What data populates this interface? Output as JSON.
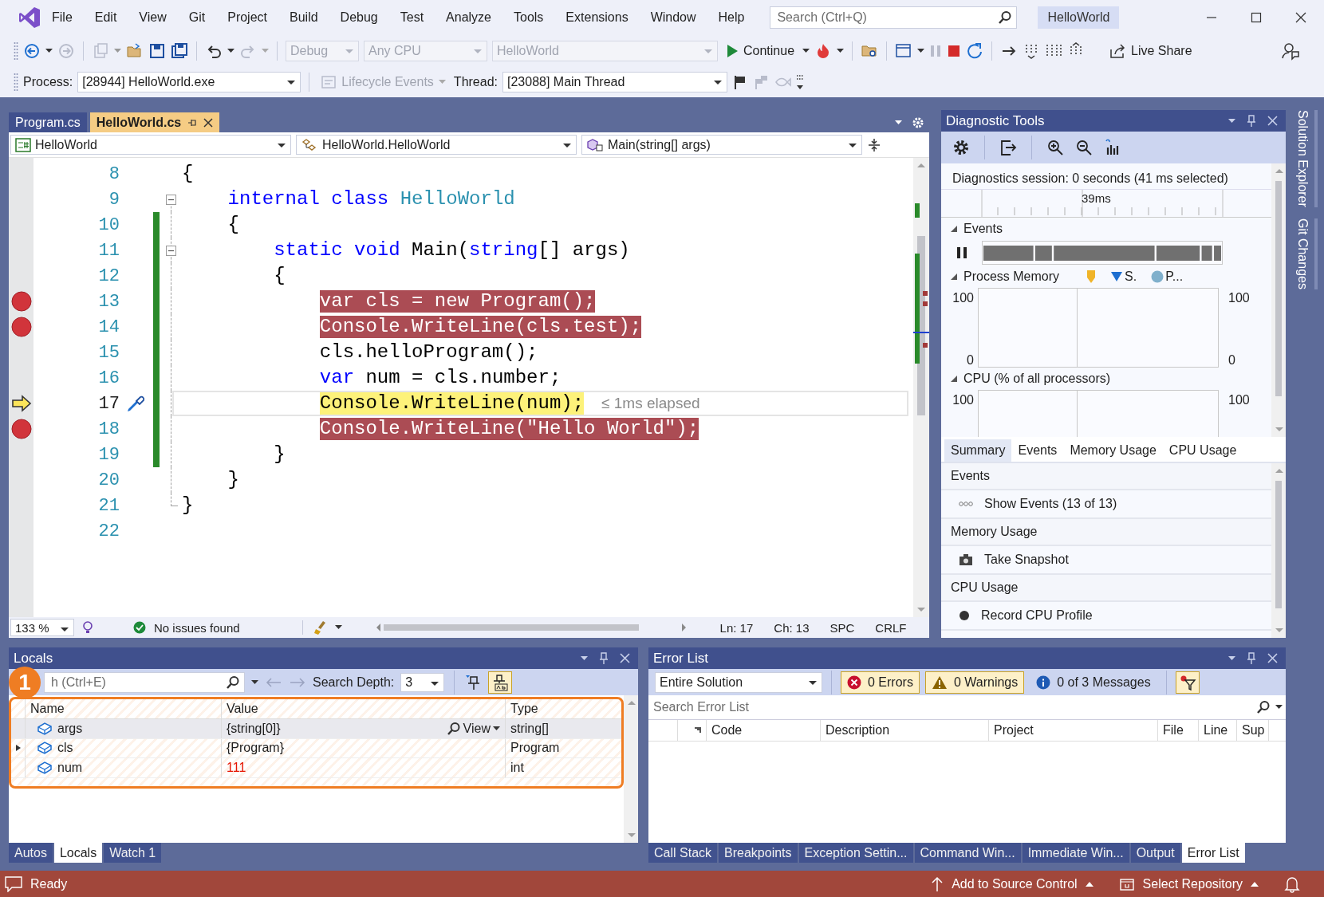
{
  "title_bar": {
    "menu": [
      "File",
      "Edit",
      "View",
      "Git",
      "Project",
      "Build",
      "Debug",
      "Test",
      "Analyze",
      "Tools",
      "Extensions",
      "Window",
      "Help"
    ],
    "search": {
      "placeholder": "Search (Ctrl+Q)"
    },
    "solution_name": "HelloWorld"
  },
  "toolbar": {
    "configuration": {
      "value": "Debug",
      "disabled": true
    },
    "platform": {
      "value": "Any CPU",
      "disabled": true
    },
    "startup_project": {
      "value": "HelloWorld",
      "disabled": true
    },
    "continue_button": "Continue",
    "live_share": "Live Share"
  },
  "debug_location": {
    "process_label": "Process:",
    "process": "[28944] HelloWorld.exe",
    "lifecycle_events": {
      "label": "Lifecycle Events",
      "disabled": true
    },
    "thread_label": "Thread:",
    "thread": "[23088] Main Thread"
  },
  "editor": {
    "tabs": [
      {
        "label": "Program.cs",
        "selected": false
      },
      {
        "label": "HelloWorld.cs",
        "selected": true
      }
    ],
    "nav": [
      "HelloWorld",
      "HelloWorld.HelloWorld",
      "Main(string[] args)"
    ],
    "lines": [
      {
        "number": "8",
        "code": [
          {
            "text": "{",
            "kind": "plain"
          }
        ],
        "breakpoint": false,
        "current": false,
        "modified": false,
        "collapsible": false
      },
      {
        "number": "9",
        "code": [
          {
            "text": "    internal class ",
            "kind": "keyword"
          },
          {
            "text": "HelloWorld",
            "kind": "type"
          }
        ],
        "breakpoint": false,
        "current": false,
        "modified": false,
        "collapsible": true
      },
      {
        "number": "10",
        "code": [
          {
            "text": "    {",
            "kind": "plain"
          }
        ],
        "breakpoint": false,
        "current": false,
        "modified": true,
        "collapsible": false
      },
      {
        "number": "11",
        "code": [
          {
            "text": "        static void ",
            "kind": "keyword"
          },
          {
            "text": "Main(",
            "kind": "plain"
          },
          {
            "text": "string",
            "kind": "keyword"
          },
          {
            "text": "[] args)",
            "kind": "plain"
          }
        ],
        "breakpoint": false,
        "current": false,
        "modified": true,
        "collapsible": true
      },
      {
        "number": "12",
        "code": [
          {
            "text": "        {",
            "kind": "plain"
          }
        ],
        "breakpoint": false,
        "current": false,
        "modified": true,
        "collapsible": false
      },
      {
        "number": "13",
        "code": [
          {
            "text": "            var cls = new Program();",
            "kind": "plain"
          }
        ],
        "breakpoint": true,
        "current": false,
        "modified": true,
        "collapsible": false
      },
      {
        "number": "14",
        "code": [
          {
            "text": "            Console.WriteLine(cls.test);",
            "kind": "plain"
          }
        ],
        "breakpoint": true,
        "current": false,
        "modified": true,
        "collapsible": false
      },
      {
        "number": "15",
        "code": [
          {
            "text": "            cls.helloProgram();",
            "kind": "plain"
          }
        ],
        "breakpoint": false,
        "current": false,
        "modified": true,
        "collapsible": false
      },
      {
        "number": "16",
        "code": [
          {
            "text": "            var",
            "kind": "keyword"
          },
          {
            "text": " num = cls.number;",
            "kind": "plain"
          }
        ],
        "breakpoint": false,
        "current": false,
        "modified": true,
        "collapsible": false
      },
      {
        "number": "17",
        "code": [
          {
            "text": "            Console.WriteLine(num);",
            "kind": "plain"
          }
        ],
        "breakpoint": false,
        "current": true,
        "modified": true,
        "collapsible": false,
        "hint": "≤ 1ms elapsed"
      },
      {
        "number": "18",
        "code": [
          {
            "text": "            Console.WriteLine(",
            "kind": "plain"
          },
          {
            "text": "\"Hello World\"",
            "kind": "string"
          },
          {
            "text": ");",
            "kind": "plain"
          }
        ],
        "breakpoint": true,
        "current": false,
        "modified": true,
        "collapsible": false
      },
      {
        "number": "19",
        "code": [
          {
            "text": "        }",
            "kind": "plain"
          }
        ],
        "breakpoint": false,
        "current": false,
        "modified": true,
        "collapsible": false
      },
      {
        "number": "20",
        "code": [
          {
            "text": "    }",
            "kind": "plain"
          }
        ],
        "breakpoint": false,
        "current": false,
        "modified": false,
        "collapsible": false
      },
      {
        "number": "21",
        "code": [
          {
            "text": "}",
            "kind": "plain"
          }
        ],
        "breakpoint": false,
        "current": false,
        "modified": false,
        "collapsible": false
      },
      {
        "number": "22",
        "breakpoint": false,
        "current": false,
        "modified": false,
        "collapsible": false
      }
    ],
    "status": {
      "zoom": "133 %",
      "issues": "No issues found",
      "line": "Ln: 17",
      "column": "Ch: 13",
      "whitespace": "SPC",
      "line_ending": "CRLF"
    }
  },
  "diagnostic_tools": {
    "title": "Diagnostic Tools",
    "session": "Diagnostics session: 0 seconds (41 ms selected)",
    "ruler_label": "39ms",
    "events_label": "Events",
    "memory": {
      "label": "Process Memory",
      "legend": [
        {
          "kind": "marker",
          "color": "#f0b429"
        },
        {
          "kind": "triangle",
          "color": "#1e6fd0",
          "label": "S."
        },
        {
          "kind": "dot",
          "color": "#80b0cc",
          "label": "P..."
        }
      ],
      "left_max": "100",
      "left_min": "0",
      "right_max": "100",
      "right_min": "0"
    },
    "cpu": {
      "label": "CPU (% of all processors)",
      "left_max": "100",
      "right_max": "100"
    },
    "tabs": [
      {
        "label": "Summary",
        "selected": true
      },
      {
        "label": "Events",
        "selected": false
      },
      {
        "label": "Memory Usage",
        "selected": false
      },
      {
        "label": "CPU Usage",
        "selected": false
      }
    ],
    "summary": [
      {
        "heading": "Events",
        "action": "Show Events (13 of 13)",
        "kind": "events"
      },
      {
        "heading": "Memory Usage",
        "action": "Take Snapshot",
        "kind": "snapshot"
      },
      {
        "heading": "CPU Usage",
        "action": "Record CPU Profile",
        "kind": "record"
      }
    ]
  },
  "side_tabs": [
    "Solution Explorer",
    "Git Changes"
  ],
  "locals": {
    "title": "Locals",
    "search_placeholder": "h (Ctrl+E)",
    "depth_label": "Search Depth:",
    "depth": "3",
    "columns": [
      "Name",
      "Value",
      "Type"
    ],
    "rows": [
      {
        "name": "args",
        "value": "{string[0]}",
        "type": "string[]",
        "expandable": false,
        "changed": false,
        "selected": true,
        "visualizer": "View"
      },
      {
        "name": "cls",
        "value": "{Program}",
        "type": "Program",
        "expandable": true,
        "changed": false,
        "selected": false
      },
      {
        "name": "num",
        "value": "111",
        "type": "int",
        "expandable": false,
        "changed": true,
        "selected": false
      }
    ],
    "tabs": [
      {
        "label": "Autos",
        "selected": false
      },
      {
        "label": "Locals",
        "selected": true
      },
      {
        "label": "Watch 1",
        "selected": false
      }
    ]
  },
  "annotation": {
    "badge": "1"
  },
  "error_list": {
    "title": "Error List",
    "scope": "Entire Solution",
    "filters": [
      {
        "label": "0 Errors",
        "kind": "error",
        "on": true
      },
      {
        "label": "0 Warnings",
        "kind": "warning",
        "on": true
      },
      {
        "label": "0 of 3 Messages",
        "kind": "message",
        "on": false
      }
    ],
    "build_filter": {
      "on": true
    },
    "search_placeholder": "Search Error List",
    "columns": [
      "Code",
      "Description",
      "Project",
      "File",
      "Line",
      "Sup"
    ],
    "tabs": [
      {
        "label": "Call Stack",
        "selected": false
      },
      {
        "label": "Breakpoints",
        "selected": false
      },
      {
        "label": "Exception Settin...",
        "selected": false
      },
      {
        "label": "Command Win...",
        "selected": false
      },
      {
        "label": "Immediate Win...",
        "selected": false
      },
      {
        "label": "Output",
        "selected": false
      },
      {
        "label": "Error List",
        "selected": true
      }
    ]
  },
  "status_bar": {
    "message": "Ready",
    "source_control": "Add to Source Control",
    "repository": "Select Repository"
  }
}
